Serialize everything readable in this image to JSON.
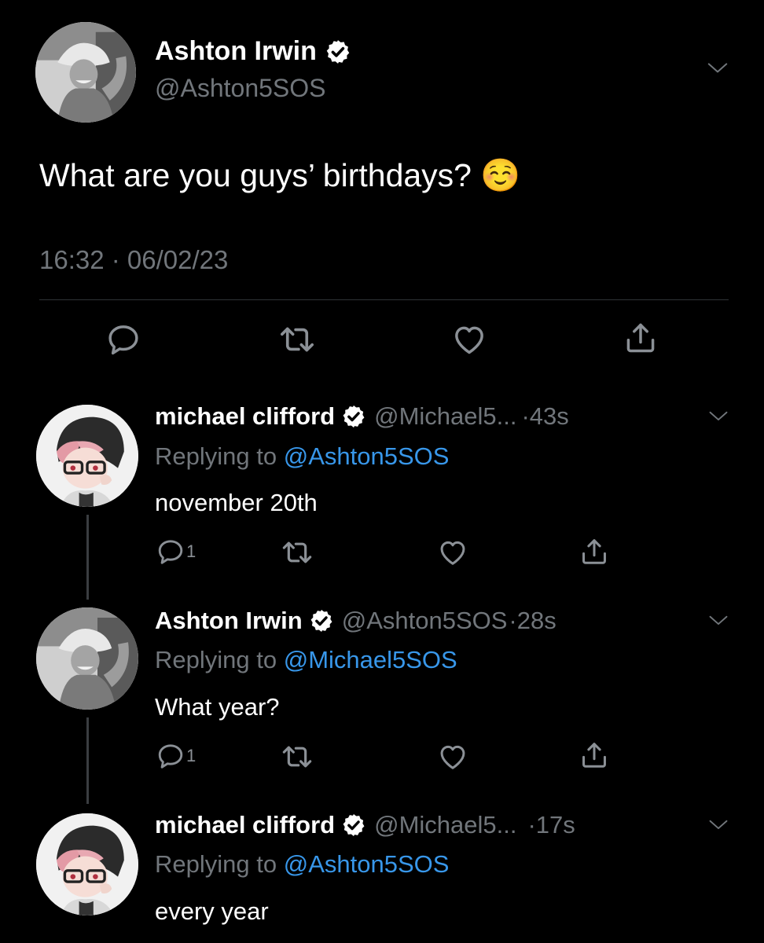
{
  "main_tweet": {
    "display_name": "Ashton Irwin",
    "handle": "@Ashton5SOS",
    "text": "What are you guys’ birthdays? ☺️",
    "timestamp": "16:32 · 06/02/23"
  },
  "replies": [
    {
      "display_name": "michael clifford",
      "handle": "@Michael5...",
      "time": "·43s",
      "replying_prefix": "Replying to ",
      "replying_to": "@Ashton5SOS",
      "text": "november 20th",
      "reply_count": "1"
    },
    {
      "display_name": "Ashton Irwin",
      "handle": "@Ashton5SOS",
      "time": "·28s",
      "replying_prefix": "Replying to ",
      "replying_to": "@Michael5SOS",
      "text": "What year?",
      "reply_count": "1"
    },
    {
      "display_name": "michael clifford",
      "handle": "@Michael5...",
      "time": "·17s",
      "replying_prefix": "Replying to ",
      "replying_to": "@Ashton5SOS",
      "text": "every year"
    }
  ],
  "colors": {
    "background": "#000000",
    "secondary_text": "#71767b",
    "link": "#3897ea",
    "icon": "#8b9096"
  },
  "icons": {
    "verified": "verified-badge-icon",
    "more": "chevron-down-icon",
    "reply": "reply-icon",
    "retweet": "retweet-icon",
    "like": "heart-icon",
    "share": "share-icon"
  }
}
